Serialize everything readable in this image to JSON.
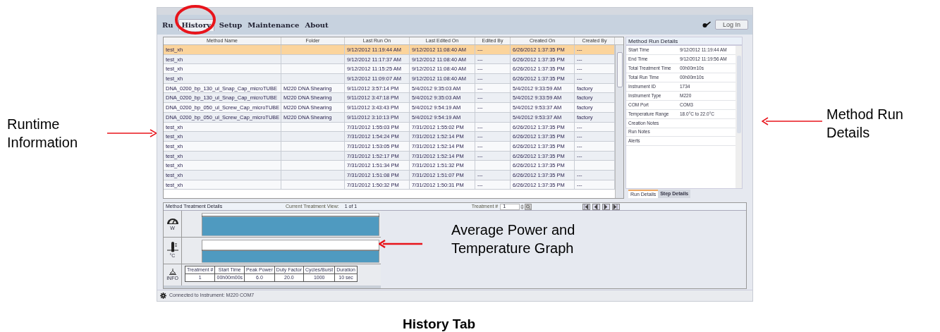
{
  "window": {
    "tabs": [
      {
        "label": "Ru",
        "selected": false
      },
      {
        "label": "History",
        "selected": true
      },
      {
        "label": "Setup",
        "selected": false
      },
      {
        "label": "Maintenance",
        "selected": false
      },
      {
        "label": "About",
        "selected": false
      }
    ],
    "login_button": "Log In"
  },
  "table": {
    "columns": [
      "Method Name",
      "Folder",
      "Last Run On",
      "Last Edited On",
      "Edited By",
      "Created On",
      "Created By"
    ],
    "rows": [
      {
        "selected": true,
        "cells": [
          "test_xh",
          "",
          "9/12/2012 11:19:44 AM",
          "9/12/2012 11:08:40 AM",
          "---",
          "6/26/2012 1:37:35 PM",
          "---"
        ]
      },
      {
        "selected": false,
        "cells": [
          "test_xh",
          "",
          "9/12/2012 11:17:37 AM",
          "9/12/2012 11:08:40 AM",
          "---",
          "6/26/2012 1:37:35 PM",
          "---"
        ]
      },
      {
        "selected": false,
        "cells": [
          "test_xh",
          "",
          "9/12/2012 11:15:25 AM",
          "9/12/2012 11:08:40 AM",
          "---",
          "6/26/2012 1:37:35 PM",
          "---"
        ]
      },
      {
        "selected": false,
        "cells": [
          "test_xh",
          "",
          "9/12/2012 11:09:07 AM",
          "9/12/2012 11:08:40 AM",
          "---",
          "6/26/2012 1:37:35 PM",
          "---"
        ]
      },
      {
        "selected": false,
        "cells": [
          "DNA_0200_bp_130_ul_Snap_Cap_microTUBE",
          "M220 DNA Shearing",
          "9/11/2012 3:57:14 PM",
          "5/4/2012 9:35:03 AM",
          "---",
          "5/4/2012 9:33:59 AM",
          "factory"
        ]
      },
      {
        "selected": false,
        "cells": [
          "DNA_0200_bp_130_ul_Snap_Cap_microTUBE",
          "M220 DNA Shearing",
          "9/11/2012 3:47:18 PM",
          "5/4/2012 9:35:03 AM",
          "---",
          "5/4/2012 9:33:59 AM",
          "factory"
        ]
      },
      {
        "selected": false,
        "cells": [
          "DNA_0200_bp_050_ul_Screw_Cap_microTUBE",
          "M220 DNA Shearing",
          "9/11/2012 3:43:43 PM",
          "5/4/2012 9:54:19 AM",
          "---",
          "5/4/2012 9:53:37 AM",
          "factory"
        ]
      },
      {
        "selected": false,
        "cells": [
          "DNA_0200_bp_050_ul_Screw_Cap_microTUBE",
          "M220 DNA Shearing",
          "9/11/2012 3:10:13 PM",
          "5/4/2012 9:54:19 AM",
          "",
          "5/4/2012 9:53:37 AM",
          "factory"
        ]
      },
      {
        "selected": false,
        "cells": [
          "test_xh",
          "",
          "7/31/2012 1:55:03 PM",
          "7/31/2012 1:55:02 PM",
          "---",
          "6/26/2012 1:37:35 PM",
          "---"
        ]
      },
      {
        "selected": false,
        "cells": [
          "test_xh",
          "",
          "7/31/2012 1:54:24 PM",
          "7/31/2012 1:52:14 PM",
          "---",
          "6/26/2012 1:37:35 PM",
          "---"
        ]
      },
      {
        "selected": false,
        "cells": [
          "test_xh",
          "",
          "7/31/2012 1:53:05 PM",
          "7/31/2012 1:52:14 PM",
          "---",
          "6/26/2012 1:37:35 PM",
          "---"
        ]
      },
      {
        "selected": false,
        "cells": [
          "test_xh",
          "",
          "7/31/2012 1:52:17 PM",
          "7/31/2012 1:52:14 PM",
          "---",
          "6/26/2012 1:37:35 PM",
          "---"
        ]
      },
      {
        "selected": false,
        "cells": [
          "test_xh",
          "",
          "7/31/2012 1:51:34 PM",
          "7/31/2012 1:51:32 PM",
          "",
          "6/26/2012 1:37:35 PM",
          ""
        ]
      },
      {
        "selected": false,
        "cells": [
          "test_xh",
          "",
          "7/31/2012 1:51:08 PM",
          "7/31/2012 1:51:07 PM",
          "---",
          "6/26/2012 1:37:35 PM",
          "---"
        ]
      },
      {
        "selected": false,
        "cells": [
          "test_xh",
          "",
          "7/31/2012 1:50:32 PM",
          "7/31/2012 1:50:31 PM",
          "---",
          "6/26/2012 1:37:35 PM",
          "---"
        ]
      }
    ]
  },
  "run_details": {
    "title": "Method Run Details",
    "rows": [
      {
        "label": "Start Time",
        "value": "9/12/2012 11:19:44 AM"
      },
      {
        "label": "End Time",
        "value": "9/12/2012 11:19:56 AM"
      },
      {
        "label": "Total Treatment Time",
        "value": "00h00m10s"
      },
      {
        "label": "Total Run Time",
        "value": "00h00m10s"
      },
      {
        "label": "Instrument ID",
        "value": "1734"
      },
      {
        "label": "Instrument Type",
        "value": "M220"
      },
      {
        "label": "COM Port",
        "value": "COM3"
      },
      {
        "label": "Temperature Range",
        "value": "18.0°C to 22.0°C"
      },
      {
        "label": "Creation Notes"
      },
      {
        "label": "Run Notes"
      },
      {
        "label": "Alerts"
      }
    ],
    "tabs": [
      {
        "label": "Run Details",
        "selected": true
      },
      {
        "label": "Step Details",
        "selected": false
      }
    ]
  },
  "treatment": {
    "title": "Method Treatment Details",
    "view_label": "Current Treatment View:",
    "view_value": "1 of 1",
    "number_label": "Treatment #",
    "number_value": "1",
    "power_unit": "W",
    "temp_unit": "°C",
    "info_label": "INFO",
    "columns": [
      "Treatment #",
      "Start Time",
      "Peak Power",
      "Duty Factor",
      "Cycles/Burst",
      "Duration"
    ],
    "row": [
      "1",
      "00h00m00s",
      "6.0",
      "20.0",
      "1000",
      "10 sec"
    ]
  },
  "status_bar": "Connected to Instrument: M220 COM7",
  "annotations": [
    {
      "kind": "left",
      "text": "Runtime Information"
    },
    {
      "kind": "right",
      "text": "Method Run Details"
    },
    {
      "kind": "graph",
      "text": "Average Power and Temperature Graph"
    }
  ],
  "caption": "History Tab"
}
